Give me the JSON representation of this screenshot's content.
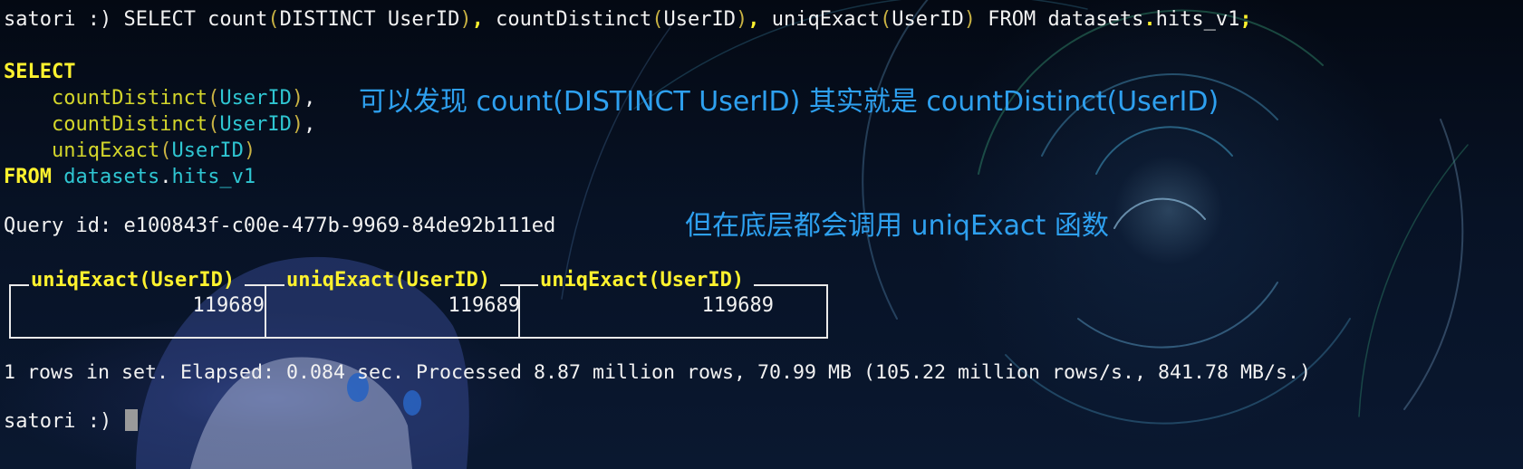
{
  "terminal": {
    "prompt": "satori :)",
    "command": {
      "p1": " SELECT count",
      "p2": "(",
      "p3": "DISTINCT UserID",
      "p4": ")",
      "p5": ", ",
      "p6": "countDistinct",
      "p7": "(",
      "p8": "UserID",
      "p9": ")",
      "p10": ", ",
      "p11": "uniqExact",
      "p12": "(",
      "p13": "UserID",
      "p14": ")",
      "p15": " FROM datasets",
      "p16": ".",
      "p17": "hits_v1",
      "p18": ";"
    },
    "formatted_query": {
      "select_kw": "SELECT",
      "fn1": "countDistinct",
      "fn2": "countDistinct",
      "fn3": "uniqExact",
      "arg": "UserID",
      "from_kw": "FROM",
      "db": "datasets",
      "table": "hits_v1"
    },
    "query_id_line": "Query id: e100843f-c00e-477b-9969-84de92b111ed",
    "result": {
      "columns": [
        "uniqExact(UserID)",
        "uniqExact(UserID)",
        "uniqExact(UserID)"
      ],
      "values": [
        "119689",
        "119689",
        "119689"
      ]
    },
    "summary_line": "1 rows in set. Elapsed: 0.084 sec. Processed 8.87 million rows, 70.99 MB (105.22 million rows/s., 841.78 MB/s.)",
    "final_prompt": "satori :)"
  },
  "annotations": {
    "note1": "可以发现 count(DISTINCT UserID) 其实就是 countDistinct(UserID)",
    "note2": "但在底层都会调用 uniqExact 函数"
  },
  "colors": {
    "keyword": "#fff22e",
    "function": "#d4d62b",
    "identifier": "#2fc6d2",
    "annotation": "#2ea0ef"
  }
}
